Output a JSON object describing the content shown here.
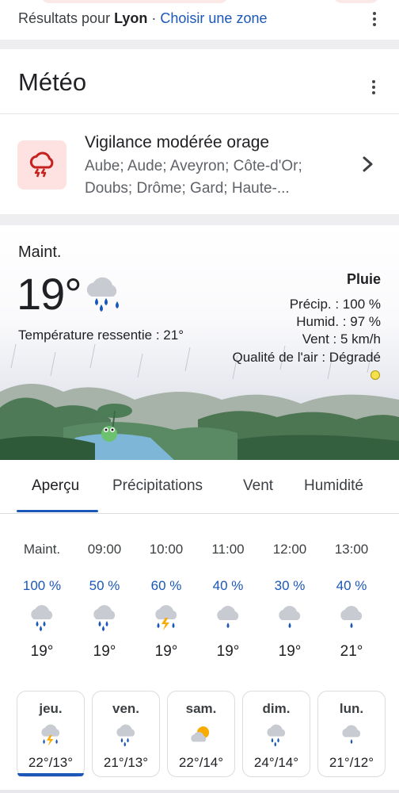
{
  "results": {
    "prefix": "Résultats pour ",
    "city": "Lyon",
    "separator": " · ",
    "link": "Choisir une zone"
  },
  "header": {
    "title": "Météo"
  },
  "alert": {
    "title": "Vigilance modérée orage",
    "regions": "Aube; Aude; Aveyron; Côte-d'Or; Doubs; Drôme; Gard; Haute-..."
  },
  "current": {
    "label": "Maint.",
    "temperature": "19°",
    "feels_like": "Température ressentie : 21°",
    "condition": "Pluie",
    "precip": "Précip. : 100 %",
    "humidity": "Humid. : 97 %",
    "wind": "Vent : 5 km/h",
    "air_quality": "Qualité de l'air : Dégradé",
    "air_quality_color": "#f6e04b"
  },
  "tabs": [
    "Aperçu",
    "Précipitations",
    "Vent",
    "Humidité"
  ],
  "hourly": [
    {
      "time": "Maint.",
      "precip": "100 %",
      "icon": "heavy-rain-icon",
      "temp": "19°"
    },
    {
      "time": "09:00",
      "precip": "50 %",
      "icon": "heavy-rain-icon",
      "temp": "19°"
    },
    {
      "time": "10:00",
      "precip": "60 %",
      "icon": "thunderstorm-icon",
      "temp": "19°"
    },
    {
      "time": "11:00",
      "precip": "40 %",
      "icon": "light-rain-icon",
      "temp": "19°"
    },
    {
      "time": "12:00",
      "precip": "30 %",
      "icon": "light-rain-icon",
      "temp": "19°"
    },
    {
      "time": "13:00",
      "precip": "40 %",
      "icon": "light-rain-icon",
      "temp": "21°"
    }
  ],
  "daily": [
    {
      "day": "jeu.",
      "icon": "thunderstorm-icon",
      "range": "22°/13°"
    },
    {
      "day": "ven.",
      "icon": "heavy-rain-icon",
      "range": "21°/13°"
    },
    {
      "day": "sam.",
      "icon": "partly-cloudy-icon",
      "range": "22°/14°"
    },
    {
      "day": "dim.",
      "icon": "heavy-rain-icon",
      "range": "24°/14°"
    },
    {
      "day": "lun.",
      "icon": "light-rain-icon",
      "range": "21°/12°"
    }
  ],
  "colors": {
    "accent": "#1a57b8",
    "alert_bg": "#fde2e1",
    "alert_icon": "#c5221f"
  }
}
